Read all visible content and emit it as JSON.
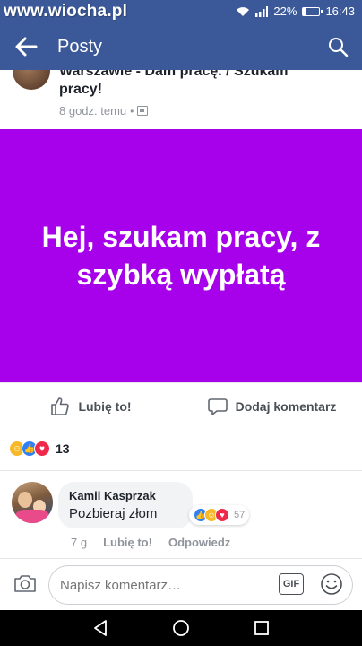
{
  "status_bar": {
    "watermark": "www.wiocha.pl",
    "battery": "22%",
    "battery_level": 0.22,
    "time": "16:43",
    "icons": [
      "wifi-icon",
      "signal-icon",
      "battery-icon"
    ]
  },
  "app_bar": {
    "title": "Posty",
    "back_icon": "arrow-left-icon",
    "search_icon": "search-icon"
  },
  "post": {
    "title_line1": "Warszawie - Dam pracę. / Szukam",
    "title_line2": "pracy!",
    "time": "8 godz. temu",
    "separator": "•",
    "banner_text": "Hej, szukam pracy, z szybką wypłatą",
    "banner_color": "#a700ea"
  },
  "actions": {
    "like": "Lubię to!",
    "comment": "Dodaj komentarz"
  },
  "reactions": {
    "icons": [
      "haha-icon",
      "like-icon",
      "love-icon"
    ],
    "count": "13"
  },
  "comment": {
    "author": "Kamil Kasprzak",
    "text": "Pozbieraj złom",
    "reactions_count": "57",
    "time": "7 g",
    "like": "Lubię to!",
    "reply": "Odpowiedz"
  },
  "composer": {
    "placeholder": "Napisz komentarz…",
    "gif": "GIF"
  },
  "colors": {
    "facebook_blue": "#3b5998",
    "banner_purple": "#a700ea",
    "muted_text": "#90949c"
  }
}
